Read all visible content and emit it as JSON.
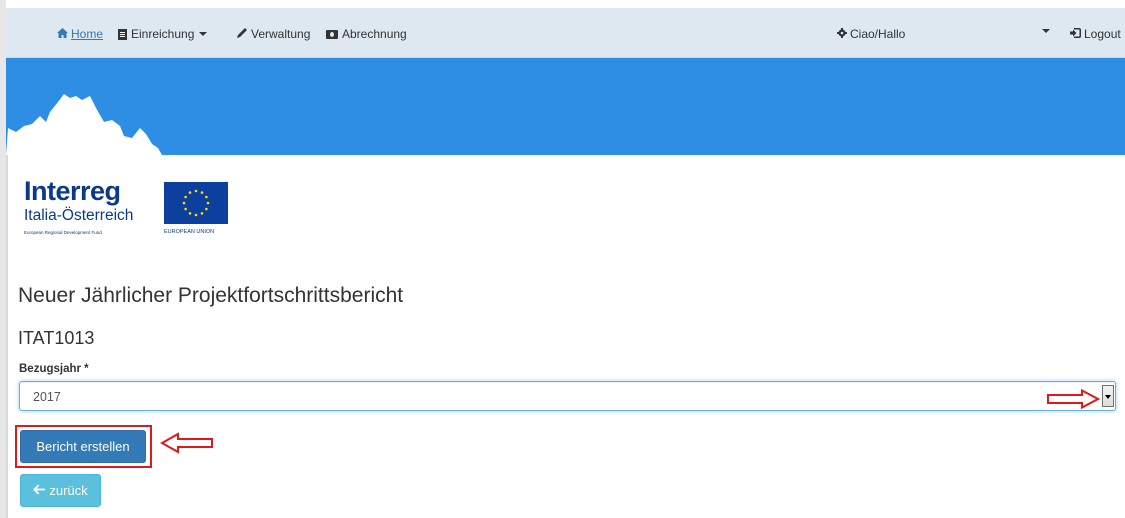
{
  "nav": {
    "home": "Home",
    "einreichung": "Einreichung",
    "verwaltung": "Verwaltung",
    "abrechnung": "Abrechnung",
    "user": "Ciao/Hallo",
    "logout": "Logout"
  },
  "logo": {
    "brand": "Interreg",
    "region": "Italia-Österreich",
    "fund": "European Regional Development Fund",
    "eu": "EUROPEAN UNION"
  },
  "main": {
    "title": "Neuer Jährlicher Projektfortschrittsbericht",
    "project_code": "ITAT1013",
    "field_label": "Bezugsjahr *",
    "selected_year": "2017",
    "create_button": "Bericht erstellen",
    "back_button": "zurück"
  },
  "colors": {
    "banner": "#2d8ee3",
    "navbar": "#dde8f1",
    "primary": "#337ab7",
    "info": "#5bc0de",
    "annotation": "#e0191b"
  }
}
